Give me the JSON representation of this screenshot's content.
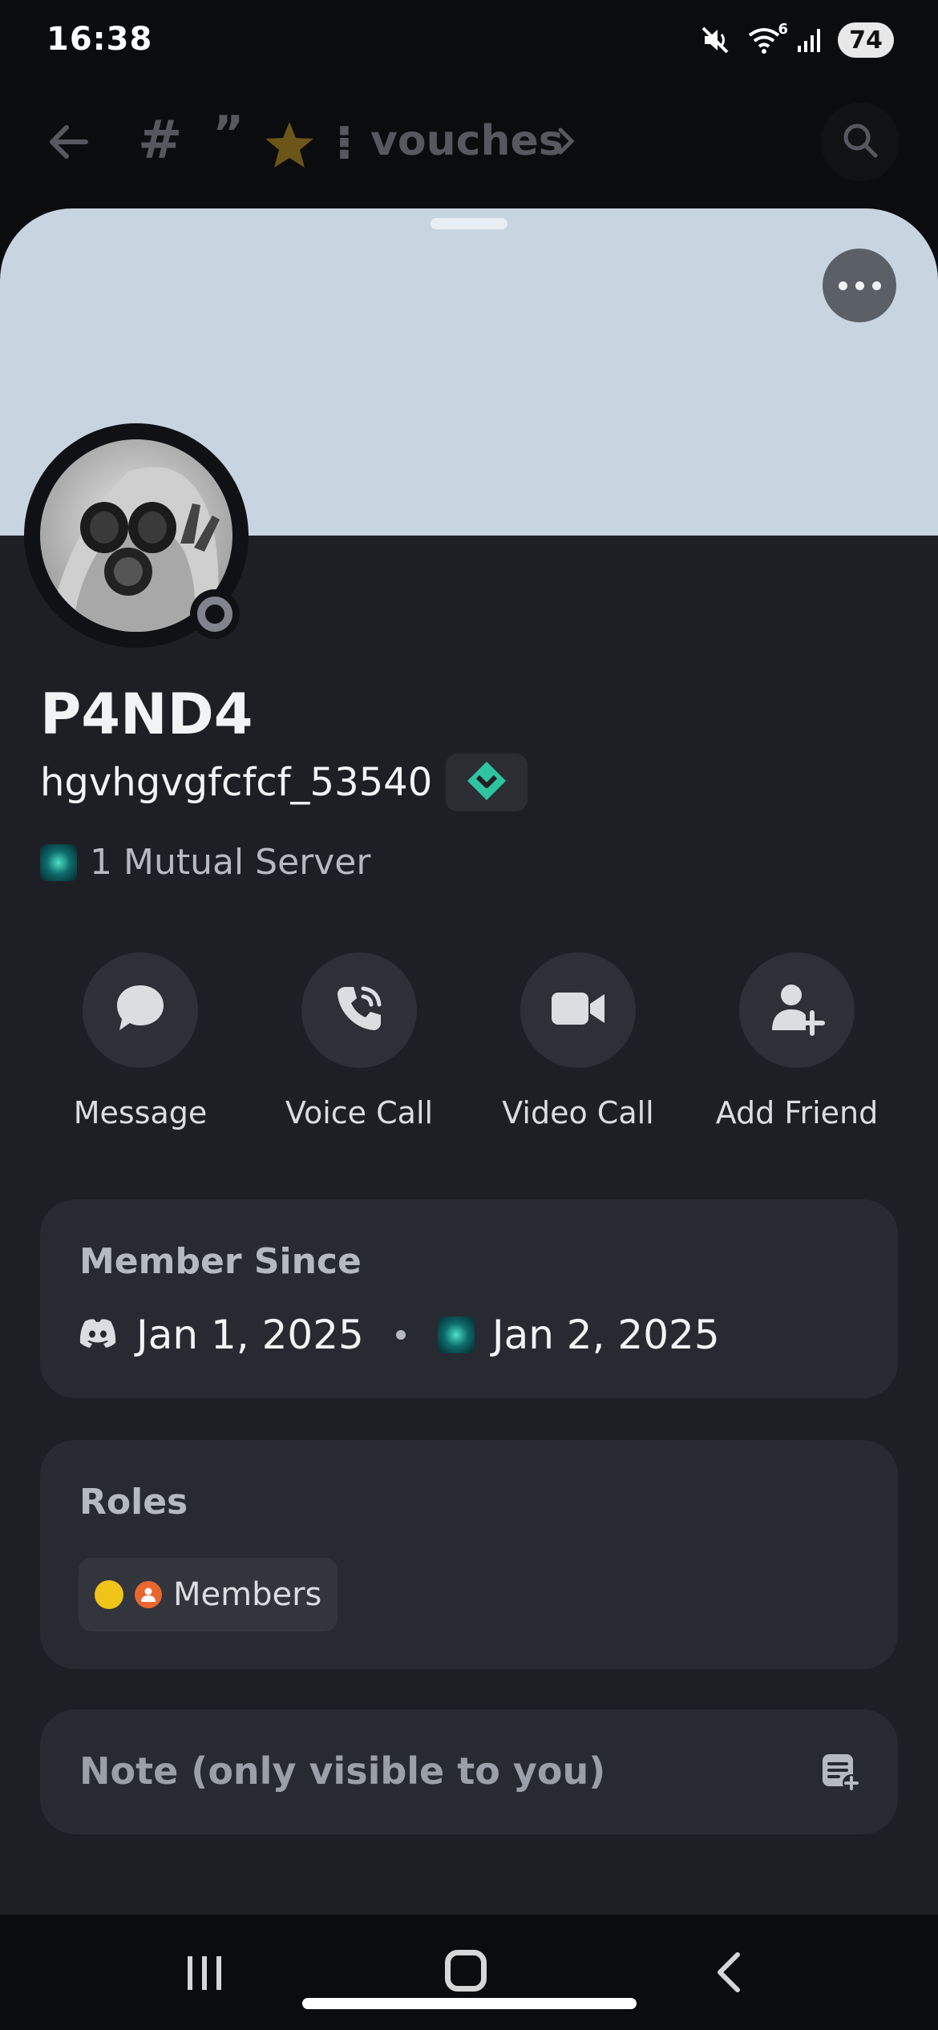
{
  "status_bar": {
    "time": "16:38",
    "battery": "74",
    "network": "6",
    "icons": [
      "mute-icon",
      "wifi-icon",
      "signal-icon",
      "battery-icon"
    ]
  },
  "channel_header": {
    "hash": "#",
    "quote": "”",
    "separator": "⁝",
    "name": "vouches",
    "icons": [
      "back-arrow-icon",
      "star-icon",
      "chevron-right-icon",
      "search-icon"
    ]
  },
  "profile": {
    "display_name": "P4ND4",
    "username": "hgvhgvgfcfcf_53540",
    "mutual_servers": "1 Mutual Server",
    "status": "offline",
    "banner_color": "#c9d4e1",
    "badge_color": "#2ec4a0"
  },
  "actions": [
    {
      "label": "Message",
      "icon": "chat-bubble-icon"
    },
    {
      "label": "Voice Call",
      "icon": "phone-call-icon"
    },
    {
      "label": "Video Call",
      "icon": "video-camera-icon"
    },
    {
      "label": "Add Friend",
      "icon": "add-friend-icon"
    }
  ],
  "member_since": {
    "title": "Member Since",
    "discord_date": "Jan 1, 2025",
    "server_date": "Jan 2, 2025"
  },
  "roles": {
    "title": "Roles",
    "items": [
      {
        "name": "Members",
        "color": "#f0c419",
        "icon_color": "#e8672e"
      }
    ]
  },
  "note": {
    "placeholder": "Note (only visible to you)"
  }
}
